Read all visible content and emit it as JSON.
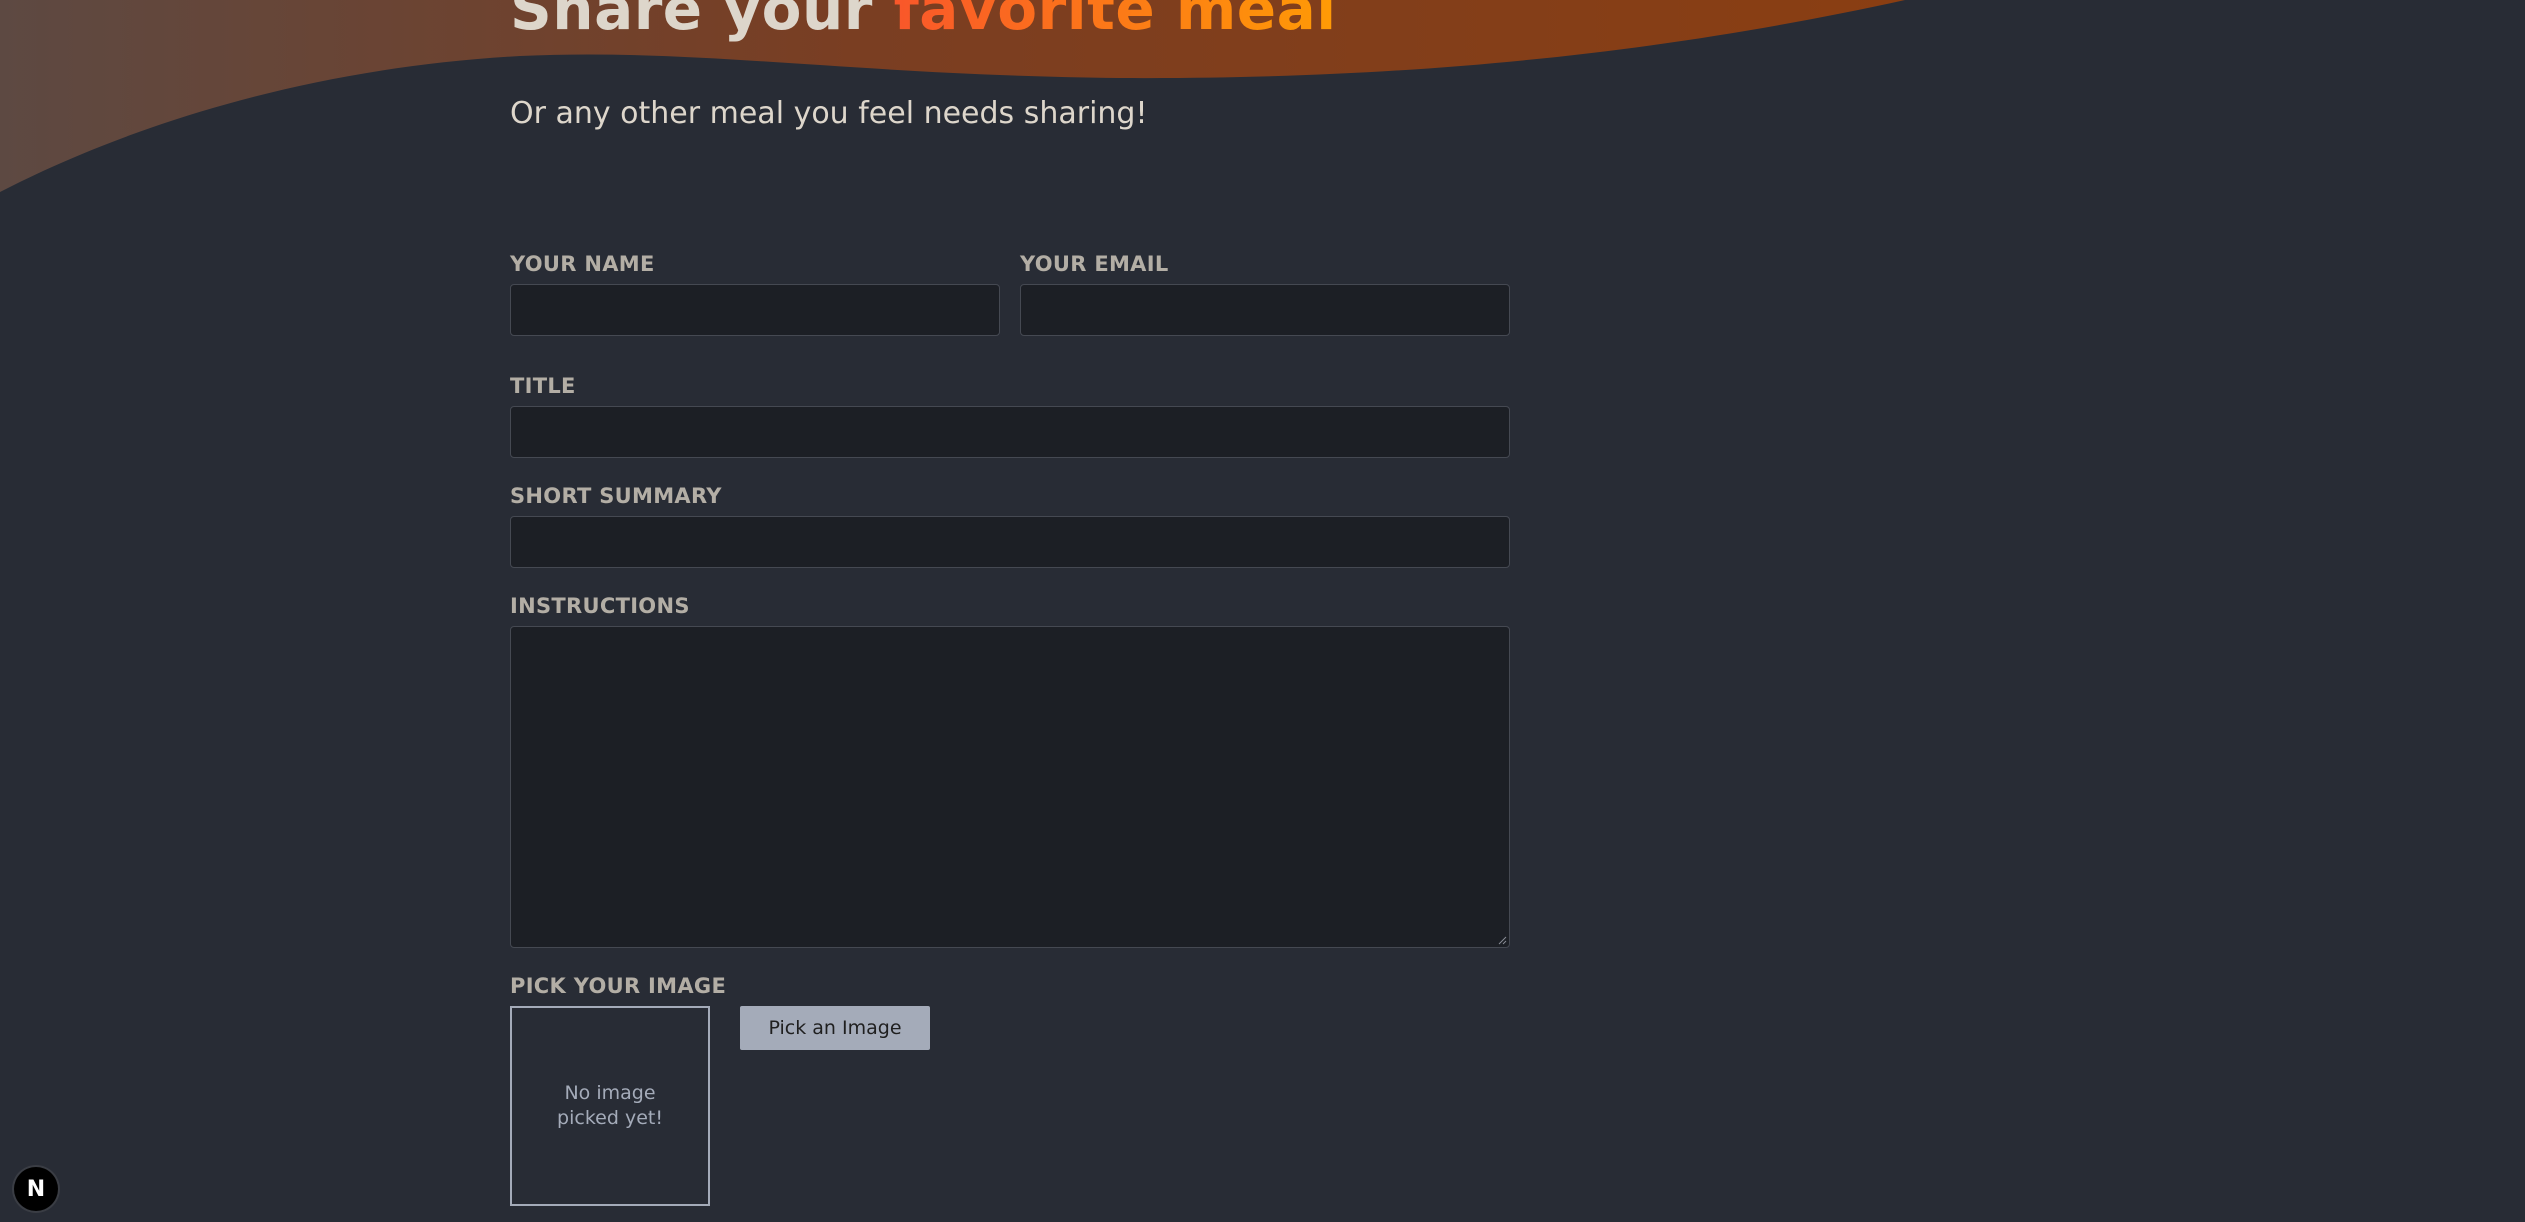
{
  "header": {
    "title_prefix": "Share your ",
    "title_highlight": "favorite meal",
    "subtitle": "Or any other meal you feel needs sharing!"
  },
  "form": {
    "name_label": "Your name",
    "email_label": "Your email",
    "title_label": "Title",
    "summary_label": "Short Summary",
    "instructions_label": "Instructions",
    "image_label": "Pick your image",
    "image_placeholder": "No image picked yet!",
    "pick_button": "Pick an Image"
  },
  "badge": {
    "letter": "N"
  },
  "colors": {
    "background": "#282c35",
    "accent_start": "#f9572a",
    "accent_end": "#ff9b05",
    "text": "#ddd6cb",
    "label": "#b3aea5",
    "input_bg": "#1c1f25",
    "button_bg": "#a4abb9"
  },
  "icons": {
    "badge": "nextjs-logo-icon",
    "resize": "resize-grip-icon"
  }
}
